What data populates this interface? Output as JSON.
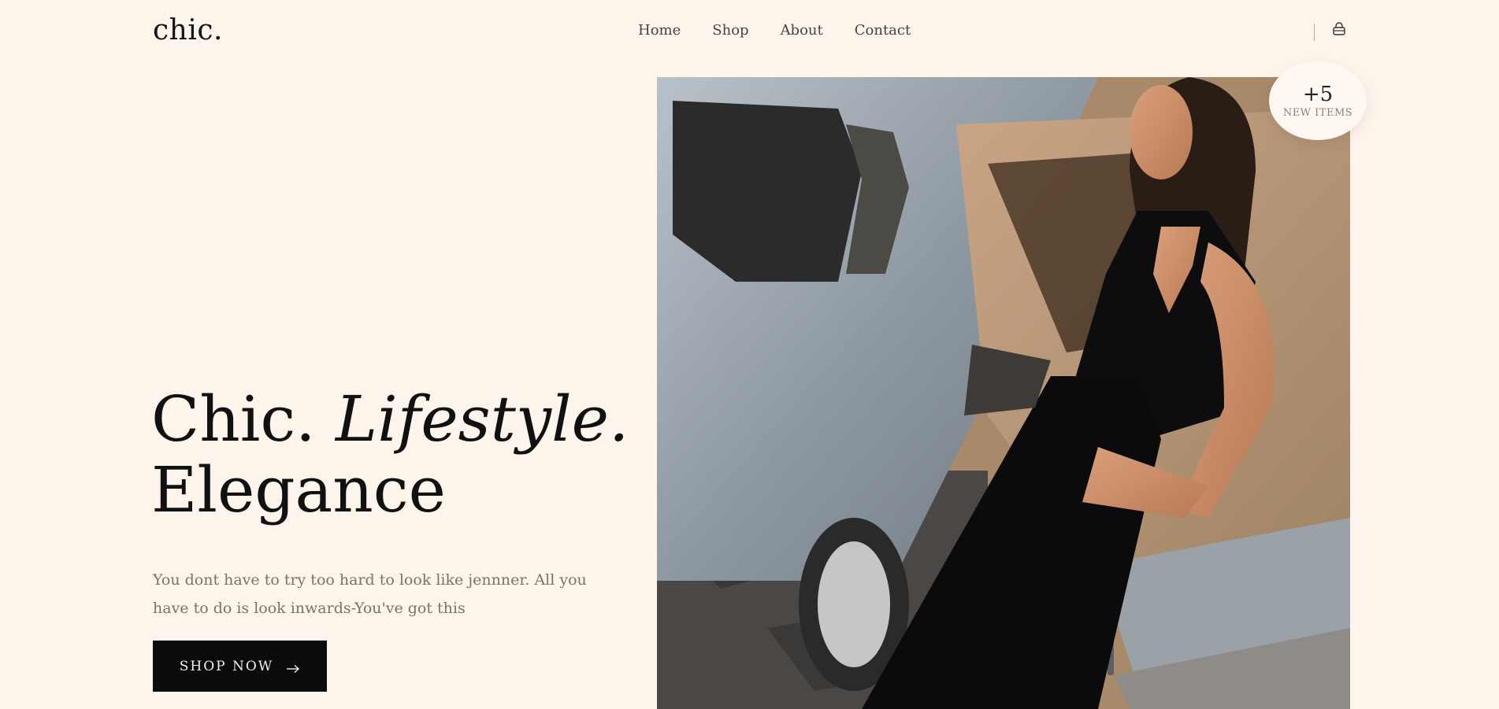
{
  "brand": {
    "logo": "chic."
  },
  "nav": {
    "items": [
      "Home",
      "Shop",
      "About",
      "Contact"
    ]
  },
  "hero": {
    "title_line1_plain": "Chic.",
    "title_line1_italic": "Lifestyle.",
    "title_line2": "Elegance",
    "description": "You dont have to try too hard to look like jennner. All you have to do is look inwards-You've got this",
    "cta_label": "SHOP NOW"
  },
  "badge": {
    "count": "+5",
    "label": "NEW ITEMS"
  },
  "icons": {
    "cart": "shopping-bag-icon",
    "cta_arrow": "arrow-right-icon"
  },
  "colors": {
    "background": "#fdf5ec",
    "cta_background": "#0c0b0b",
    "text": "#111111",
    "muted_text": "#7a726b"
  }
}
